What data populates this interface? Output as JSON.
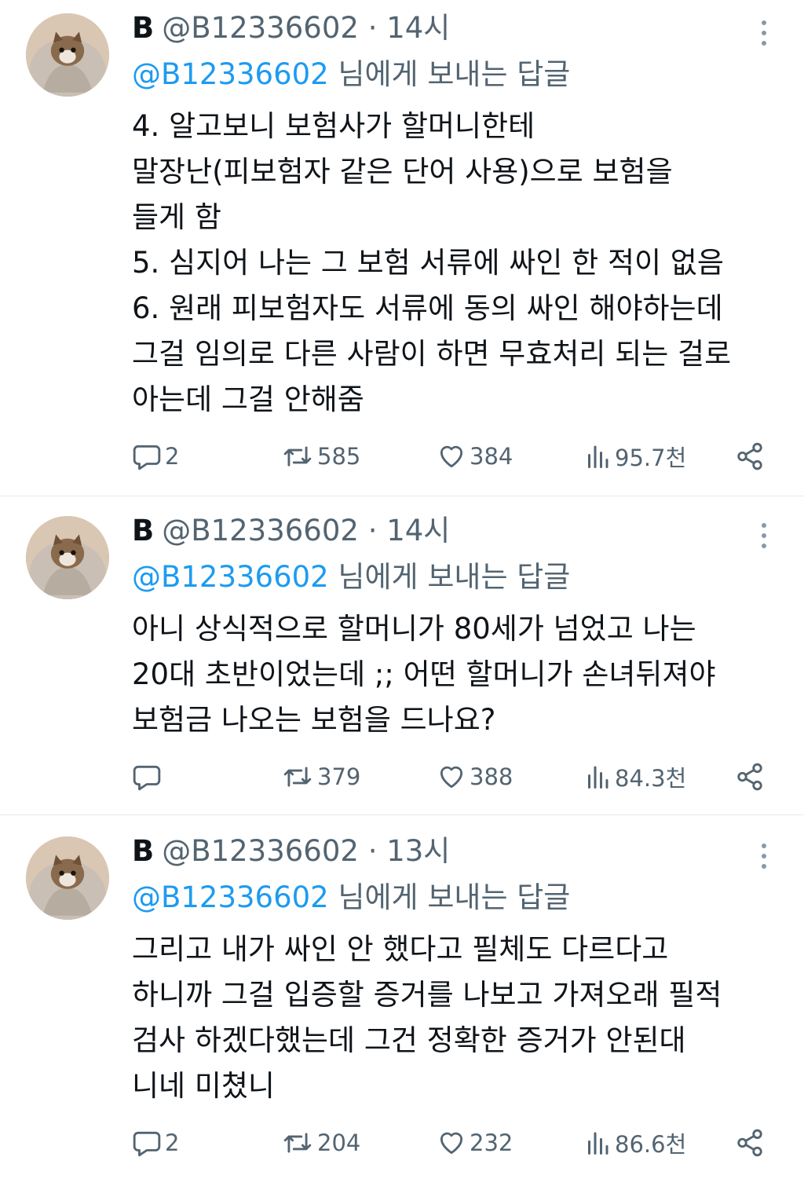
{
  "tweets": [
    {
      "name": "B",
      "handle": "@B12336602",
      "time": "· 14시",
      "reply_mention": "@B12336602",
      "reply_suffix": " 님에게 보내는 답글",
      "text": "4. 알고보니 보험사가 할머니한테\n말장난(피보험자 같은 단어 사용)으로 보험을\n들게 함\n5. 심지어 나는 그 보험 서류에 싸인 한 적이 없음\n6. 원래 피보험자도 서류에 동의 싸인 해야하는데\n그걸 임의로 다른 사람이 하면 무효처리 되는 걸로\n아는데 그걸 안해줌",
      "replies": "2",
      "retweets": "585",
      "likes": "384",
      "views": "95.7천"
    },
    {
      "name": "B",
      "handle": "@B12336602",
      "time": "· 14시",
      "reply_mention": "@B12336602",
      "reply_suffix": " 님에게 보내는 답글",
      "text": "아니 상식적으로 할머니가 80세가 넘었고 나는\n20대 초반이었는데 ;; 어떤 할머니가 손녀뒤져야\n보험금 나오는 보험을 드나요?",
      "replies": "",
      "retweets": "379",
      "likes": "388",
      "views": "84.3천"
    },
    {
      "name": "B",
      "handle": "@B12336602",
      "time": "· 13시",
      "reply_mention": "@B12336602",
      "reply_suffix": " 님에게 보내는 답글",
      "text": "그리고 내가 싸인 안 했다고 필체도 다르다고\n하니까 그걸 입증할 증거를 나보고 가져오래 필적\n검사 하겠다했는데 그건 정확한 증거가 안된대\n니네 미쳤니",
      "replies": "2",
      "retweets": "204",
      "likes": "232",
      "views": "86.6천"
    }
  ],
  "icons": {
    "reply": "reply-icon",
    "retweet": "retweet-icon",
    "like": "heart-icon",
    "views": "views-icon",
    "share": "share-icon",
    "more": "more-icon"
  },
  "colors": {
    "text": "#0f1419",
    "secondary": "#536471",
    "link": "#1d9bf0",
    "divider": "#e6e9ec"
  }
}
